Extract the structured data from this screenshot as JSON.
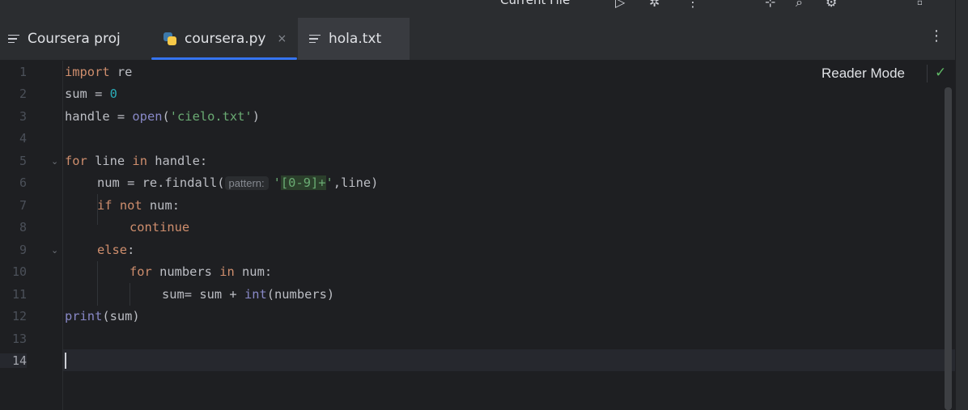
{
  "toolbar": {
    "run_config": "Current File ˅"
  },
  "tabs": [
    {
      "label": "Coursera proj",
      "icon": "text-lines-icon"
    },
    {
      "label": "coursera.py",
      "icon": "python-icon",
      "close": "×",
      "active": true
    },
    {
      "label": "hola.txt",
      "icon": "text-lines-icon"
    }
  ],
  "editor": {
    "reader_mode": "Reader Mode",
    "line_numbers": [
      "1",
      "2",
      "3",
      "4",
      "5",
      "6",
      "7",
      "8",
      "9",
      "10",
      "11",
      "12",
      "13",
      "14"
    ],
    "lines": {
      "l1_kw": "import",
      "l1_rest": " re",
      "l2_a": "sum = ",
      "l2_num": "0",
      "l3_a": "handle = ",
      "l3_fn": "open",
      "l3_b": "(",
      "l3_str": "'cielo.txt'",
      "l3_c": ")",
      "l5_kw1": "for",
      "l5_a": " line ",
      "l5_kw2": "in",
      "l5_b": " handle:",
      "l6_a": "num = re.findall(",
      "l6_hint": "pattern:",
      "l6_q1": "'",
      "l6_rx": "[0-9]+",
      "l6_q2": "'",
      "l6_b": ",line)",
      "l7_kw1": "if",
      "l7_sp": " ",
      "l7_kw2": "not",
      "l7_b": " num:",
      "l8_kw": "continue",
      "l9_kw": "else",
      "l9_b": ":",
      "l10_kw1": "for",
      "l10_a": " numbers ",
      "l10_kw2": "in",
      "l10_b": " num:",
      "l11_a": "sum= sum + ",
      "l11_fn": "int",
      "l11_b": "(numbers)",
      "l12_fn": "print",
      "l12_b": "(sum)"
    },
    "current_line": "14",
    "colors": {
      "keyword": "#cf8e6d",
      "number": "#2aacb8",
      "string": "#6aab73",
      "builtin": "#8888c6",
      "accent": "#3574f0"
    }
  }
}
